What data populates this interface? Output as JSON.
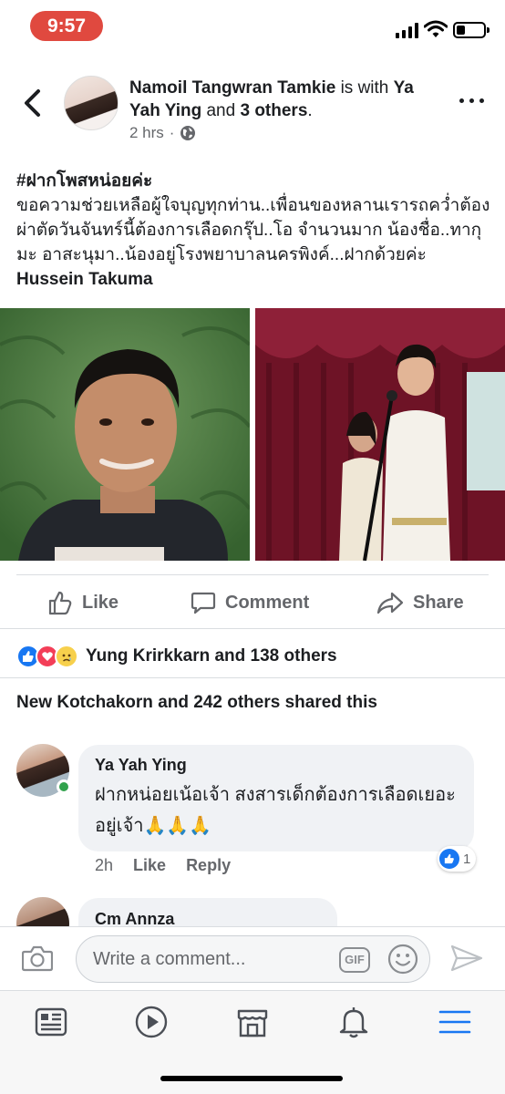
{
  "status_bar": {
    "time": "9:57"
  },
  "post": {
    "author": "Namoil Tangwran Tamkie",
    "with_text": "is with",
    "tagged": "Ya Yah Ying",
    "and_text": "and",
    "others": "3 others",
    "period": ".",
    "time": "2 hrs",
    "privacy_sep": "·",
    "hashtag": "#ฝากโพสหน่อยค่ะ",
    "body": "ขอความช่วยเหลือผู้ใจบุญทุกท่าน..เพื่อนของหลานเรารถคว่ำต้องผ่าตัดวันจันทร์นี้ต้องการเลือดกรุ๊ป..โอ จำนวนมาก น้องชื่อ..ทากุมะ อาสะนุมา..น้องอยู่โรงพยาบาลนครพิงค์...ฝากด้วยค่ะ",
    "mention": "Hussein Takuma"
  },
  "actions": {
    "like": "Like",
    "comment": "Comment",
    "share": "Share"
  },
  "reactions": {
    "summary": "Yung Krirkkarn and 138 others"
  },
  "shares": {
    "summary": "New Kotchakorn and 242 others shared this"
  },
  "comments": [
    {
      "name": "Ya Yah Ying",
      "text": "ฝากหน่อยเน้อเจ้า สงสารเด็กต้องการเลือดเยอะอยู่เจ้า🙏🙏🙏",
      "time": "2h",
      "like_label": "Like",
      "reply_label": "Reply",
      "like_count": "1"
    },
    {
      "name": "Cm Annza"
    }
  ],
  "composer": {
    "placeholder": "Write a comment...",
    "gif_label": "GIF"
  },
  "colors": {
    "accent": "#1877f2",
    "time_pill": "#e0493f",
    "bubble": "#f0f2f5"
  }
}
